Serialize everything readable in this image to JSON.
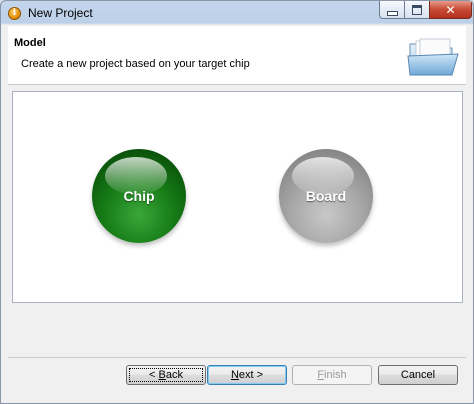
{
  "window": {
    "title": "New Project",
    "icon": "info-icon"
  },
  "header": {
    "title": "Model",
    "description": "Create a new project based on your target chip",
    "icon": "folder-icon"
  },
  "options": {
    "chip_label": "Chip",
    "board_label": "Board",
    "chip_color": "#157a15",
    "board_color": "#a6a6a6"
  },
  "buttons": {
    "back_prefix": "< ",
    "back_key": "B",
    "back_rest": "ack",
    "next_key": "N",
    "next_rest": "ext >",
    "finish_key": "F",
    "finish_rest": "inish",
    "cancel": "Cancel"
  }
}
